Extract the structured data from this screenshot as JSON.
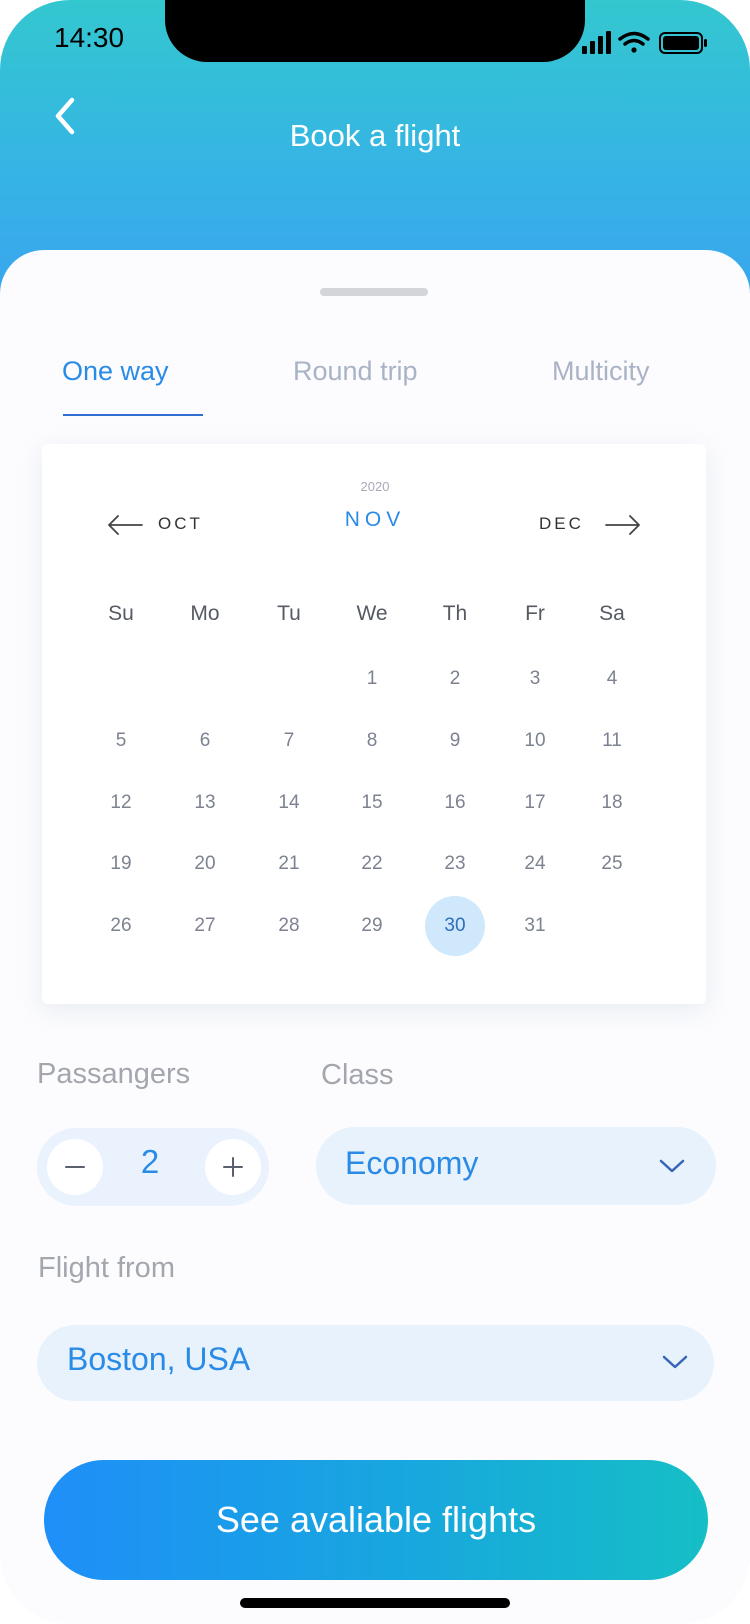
{
  "status_bar": {
    "time": "14:30"
  },
  "header": {
    "title": "Book a flight"
  },
  "tabs": [
    {
      "label": "One way",
      "active": true
    },
    {
      "label": "Round trip",
      "active": false
    },
    {
      "label": "Multicity",
      "active": false
    }
  ],
  "calendar": {
    "year": "2020",
    "current_month": "NOV",
    "prev_month": "OCT",
    "next_month": "DEC",
    "weekdays": [
      "Su",
      "Mo",
      "Tu",
      "We",
      "Th",
      "Fr",
      "Sa"
    ],
    "weeks": [
      [
        "",
        "",
        "",
        "1",
        "2",
        "3",
        "4"
      ],
      [
        "5",
        "6",
        "7",
        "8",
        "9",
        "10",
        "11"
      ],
      [
        "12",
        "13",
        "14",
        "15",
        "16",
        "17",
        "18"
      ],
      [
        "19",
        "20",
        "21",
        "22",
        "23",
        "24",
        "25"
      ],
      [
        "26",
        "27",
        "28",
        "29",
        "30",
        "31",
        ""
      ]
    ],
    "selected_day": "30"
  },
  "passengers": {
    "label": "Passangers",
    "value": "2"
  },
  "class": {
    "label": "Class",
    "value": "Economy"
  },
  "flight_from": {
    "label": "Flight from",
    "value": "Boston, USA"
  },
  "cta": {
    "label": "See avaliable flights"
  },
  "colors": {
    "accent": "#2a8be6",
    "header_top": "#33c7cf",
    "header_bottom": "#3aa2f0",
    "selected_day_bg": "#cfe8fb"
  }
}
